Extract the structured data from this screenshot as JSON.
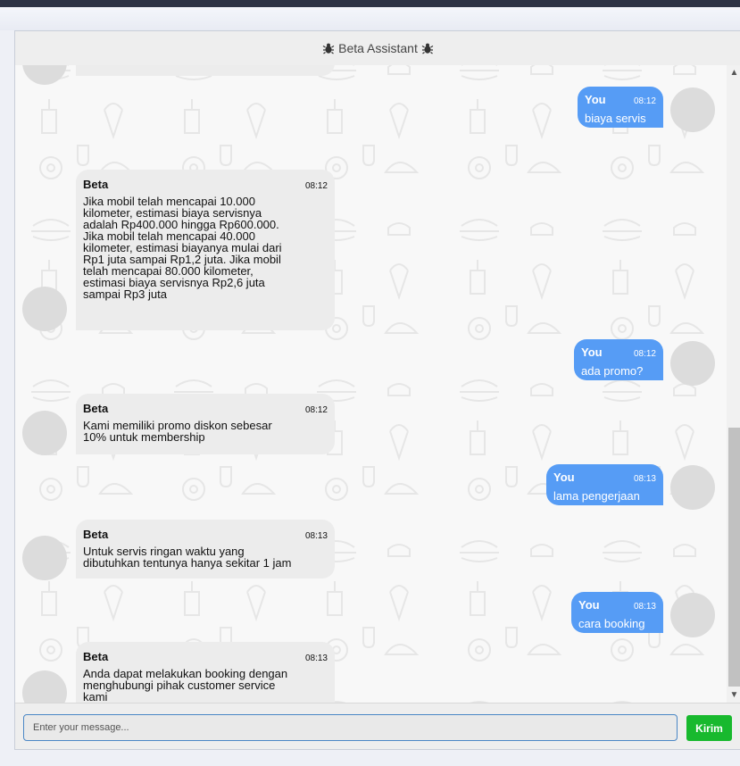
{
  "header": {
    "title": "Beta Assistant",
    "icon": "bug-icon"
  },
  "messages": [
    {
      "sender": "You",
      "time": "08:12",
      "text": "biaya servis",
      "side": "user"
    },
    {
      "sender": "Beta",
      "time": "08:12",
      "side": "bot",
      "lines": [
        "Jika mobil telah mencapai 10.000",
        "kilometer, estimasi biaya servisnya",
        "adalah Rp400.000 hingga Rp600.000.",
        "Jika mobil telah mencapai 40.000",
        "kilometer, estimasi biayanya mulai dari",
        "Rp1 juta sampai Rp1,2 juta. Jika mobil",
        "telah mencapai 80.000 kilometer,",
        "estimasi biaya servisnya Rp2,6 juta",
        "sampai Rp3 juta"
      ]
    },
    {
      "sender": "You",
      "time": "08:12",
      "text": "ada promo?",
      "side": "user"
    },
    {
      "sender": "Beta",
      "time": "08:12",
      "side": "bot",
      "lines": [
        "Kami memiliki promo diskon sebesar",
        "10% untuk membership"
      ]
    },
    {
      "sender": "You",
      "time": "08:13",
      "text": "lama pengerjaan",
      "side": "user"
    },
    {
      "sender": "Beta",
      "time": "08:13",
      "side": "bot",
      "lines": [
        "Untuk servis ringan waktu yang",
        "dibutuhkan tentunya hanya sekitar 1 jam"
      ]
    },
    {
      "sender": "You",
      "time": "08:13",
      "text": "cara booking",
      "side": "user"
    },
    {
      "sender": "Beta",
      "time": "08:13",
      "side": "bot",
      "lines": [
        "Anda dapat melakukan booking dengan",
        "menghubungi pihak customer service",
        "kami"
      ]
    }
  ],
  "input": {
    "placeholder": "Enter your message...",
    "value": ""
  },
  "send": {
    "label": "Kirim"
  },
  "colors": {
    "user_bubble": "#569cf5",
    "bot_bubble": "#ececec",
    "send_button": "#18b92e"
  }
}
